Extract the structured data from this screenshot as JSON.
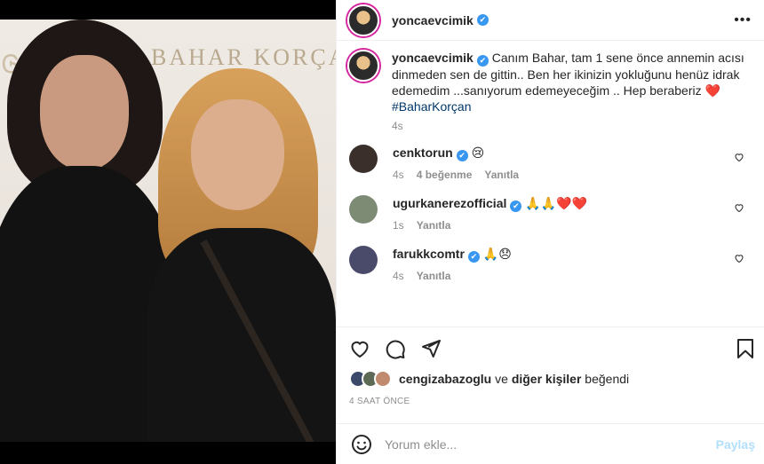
{
  "post": {
    "username": "yoncaevcimik",
    "verified_mark": "✔",
    "more_icon": "•••",
    "photo_wall_text": "BAHAR KORÇAN"
  },
  "caption": {
    "username": "yoncaevcimik",
    "text": "Canım Bahar, tam 1 sene önce annemin acısı dinmeden sen de gittin.. Ben her ikinizin yokluğunu henüz idrak edemedim ...sanıyorum edemeyeceğim .. Hep beraberiz",
    "emoji": "❤️",
    "hashtag": "#BaharKorçan",
    "time": "4s"
  },
  "comments": [
    {
      "username": "cenktorun",
      "text": "😢",
      "time": "4s",
      "likes": "4 beğenme",
      "reply": "Yanıtla",
      "avatar_color": "#3a2f2a"
    },
    {
      "username": "ugurkanerezofficial",
      "text": "🙏🙏❤️❤️",
      "time": "1s",
      "likes": "",
      "reply": "Yanıtla",
      "avatar_color": "#7d8a74"
    },
    {
      "username": "farukkcomtr",
      "text": "🙏😞",
      "time": "4s",
      "likes": "",
      "reply": "Yanıtla",
      "avatar_color": "#4a4a6a"
    }
  ],
  "likes": {
    "liker": "cengizabazoglu",
    "and": "ve",
    "others": "diğer kişiler",
    "suffix": "beğendi"
  },
  "timestamp": "4 SAAT ÖNCE",
  "add_comment": {
    "placeholder": "Yorum ekle...",
    "post_label": "Paylaş"
  },
  "icons": [
    "more-icon",
    "heart-icon",
    "comment-icon",
    "share-icon",
    "bookmark-icon",
    "emoji-icon"
  ],
  "colors": {
    "verified": "#3897f0",
    "hashtag": "#00376b",
    "post_button": "#b2dffc",
    "muted": "#8e8e8e"
  }
}
